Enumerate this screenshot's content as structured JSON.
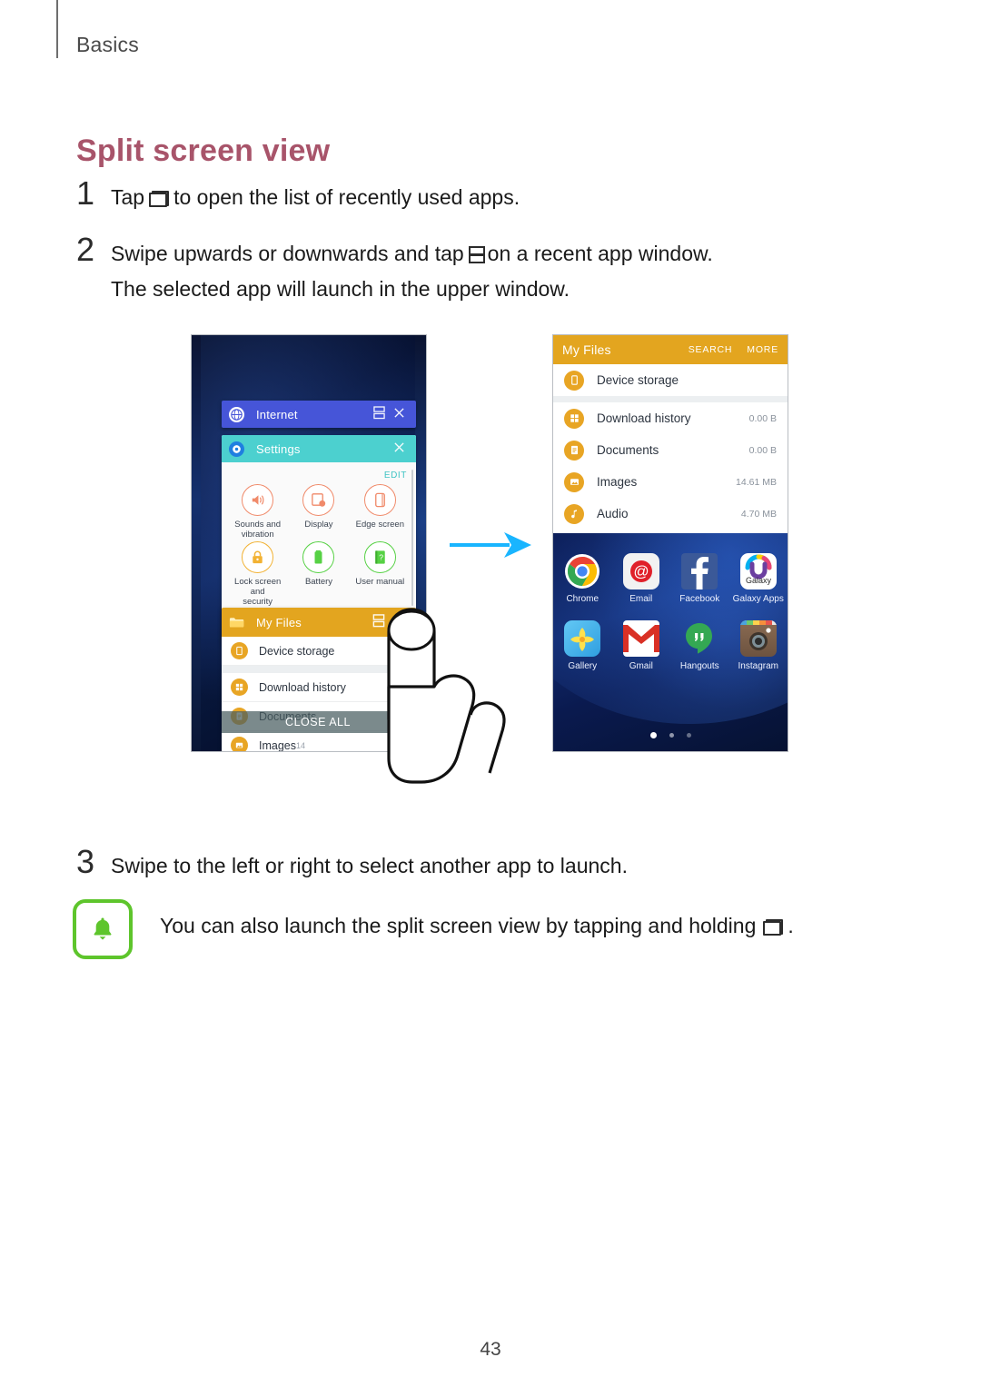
{
  "page": {
    "breadcrumb": "Basics",
    "title": "Split screen view",
    "number": "43"
  },
  "steps": [
    {
      "num": "1",
      "text_before": "Tap",
      "icon": "recents-icon",
      "text_after": "to open the list of recently used apps."
    },
    {
      "num": "2",
      "text_before": "Swipe upwards or downwards and tap",
      "icon": "split-screen-icon",
      "text_after": "on a recent app window.",
      "sub": "The selected app will launch in the upper window."
    },
    {
      "num": "3",
      "text_before": "Swipe to the left or right to select another app to launch.",
      "icon": "",
      "text_after": ""
    }
  ],
  "note": {
    "icon": "bell-icon",
    "text_before": "You can also launch the split screen view by tapping and holding",
    "icon_inline": "recents-icon",
    "text_after": "."
  },
  "figure": {
    "arrow": "arrow-right-icon",
    "arrow_color": "#19b5ff",
    "left_phone": {
      "name": "recent-apps-screen",
      "cards": [
        {
          "app": "Internet",
          "icon": "globe-icon",
          "bar_color": "#4655d8",
          "buttons": [
            "split-screen-icon",
            "close-icon"
          ]
        },
        {
          "app": "Settings",
          "icon": "gear-icon",
          "bar_color": "#4cd0cf",
          "buttons": [
            "close-icon"
          ],
          "edit_label": "EDIT",
          "tiles": [
            {
              "label": "Sounds and\nvibration",
              "icon": "speaker-icon",
              "color": "#f08a6a"
            },
            {
              "label": "Display",
              "icon": "display-icon",
              "color": "#f08a6a"
            },
            {
              "label": "Edge screen",
              "icon": "edge-screen-icon",
              "color": "#f08a6a"
            },
            {
              "label": "Lock screen and\nsecurity",
              "icon": "lock-icon",
              "color": "#f2b233"
            },
            {
              "label": "Battery",
              "icon": "battery-icon",
              "color": "#56d144"
            },
            {
              "label": "User manual",
              "icon": "manual-icon",
              "color": "#56d144"
            }
          ]
        },
        {
          "app": "My Files",
          "icon": "folder-icon",
          "bar_color": "#e3a51f",
          "buttons": [
            "split-screen-icon",
            "close-icon"
          ],
          "rows": [
            {
              "label": "Device storage",
              "icon": "device-icon"
            },
            {
              "label": "Download history",
              "icon": "download-icon"
            },
            {
              "label": "Documents",
              "icon": "document-icon"
            },
            {
              "label": "Images",
              "icon": "image-icon",
              "size": "14"
            }
          ]
        }
      ],
      "close_all_label": "CLOSE ALL",
      "finger": "finger-tap-icon"
    },
    "right_phone": {
      "name": "split-screen-result",
      "top_app": {
        "title": "My Files",
        "actions": [
          "SEARCH",
          "MORE"
        ],
        "rows": [
          {
            "label": "Device storage",
            "icon": "device-icon",
            "size": ""
          },
          {
            "label": "Download history",
            "icon": "download-icon",
            "size": "0.00 B"
          },
          {
            "label": "Documents",
            "icon": "document-icon",
            "size": "0.00 B"
          },
          {
            "label": "Images",
            "icon": "image-icon",
            "size": "14.61 MB"
          },
          {
            "label": "Audio",
            "icon": "audio-icon",
            "size": "4.70 MB"
          }
        ]
      },
      "home_screen": {
        "apps": [
          {
            "label": "Chrome",
            "icon": "chrome-icon"
          },
          {
            "label": "Email",
            "icon": "email-icon"
          },
          {
            "label": "Facebook",
            "icon": "facebook-icon"
          },
          {
            "label": "Galaxy Apps",
            "icon": "galaxy-apps-icon",
            "badge": "Galaxy"
          },
          {
            "label": "Gallery",
            "icon": "gallery-icon"
          },
          {
            "label": "Gmail",
            "icon": "gmail-icon"
          },
          {
            "label": "Hangouts",
            "icon": "hangouts-icon"
          },
          {
            "label": "Instagram",
            "icon": "instagram-icon"
          }
        ],
        "page_dots": 3,
        "active_dot": 1
      }
    }
  }
}
